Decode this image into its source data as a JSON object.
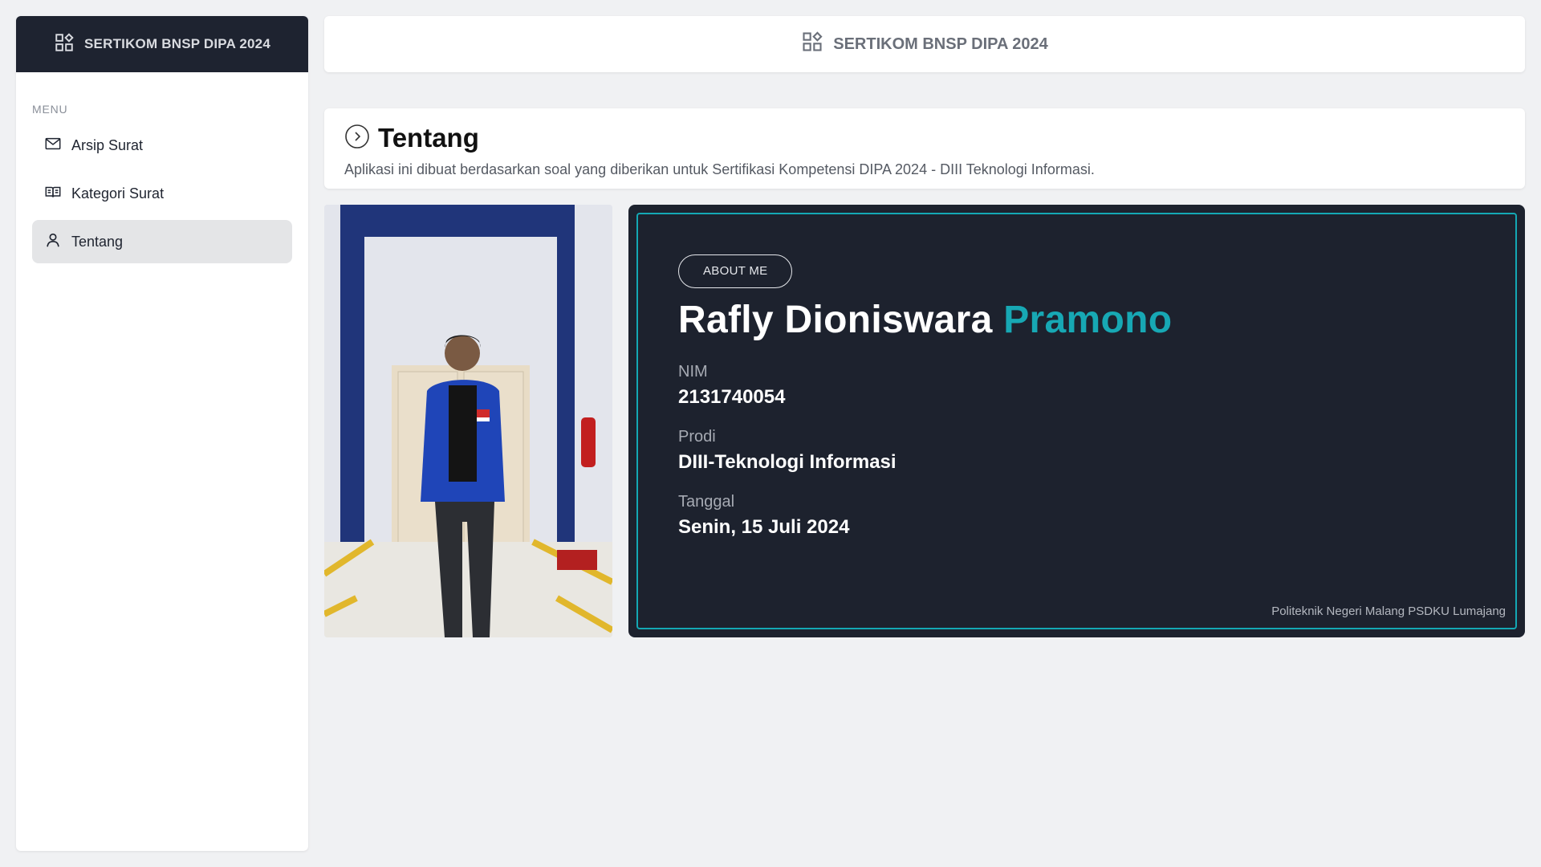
{
  "app": {
    "title": "SERTIKOM BNSP DIPA 2024"
  },
  "sidebar": {
    "title": "SERTIKOM BNSP DIPA 2024",
    "menu_label": "MENU",
    "items": [
      {
        "label": "Arsip Surat",
        "icon": "mail-icon",
        "active": false
      },
      {
        "label": "Kategori Surat",
        "icon": "book-open-icon",
        "active": false
      },
      {
        "label": "Tentang",
        "icon": "user-icon",
        "active": true
      }
    ]
  },
  "header": {
    "title": "SERTIKOM BNSP DIPA 2024",
    "icon": "dashboard-icon"
  },
  "page": {
    "title": "Tentang",
    "title_icon": "chevron-right-circle-icon",
    "description": "Aplikasi ini dibuat berdasarkan soal yang diberikan untuk Sertifikasi Kompetensi DIPA 2024 - DIII Teknologi Informasi."
  },
  "about": {
    "badge": "ABOUT ME",
    "name_main": "Rafly Dioniswara",
    "name_accent": "Pramono",
    "fields": [
      {
        "label": "NIM",
        "value": "2131740054"
      },
      {
        "label": "Prodi",
        "value": "DIII-Teknologi Informasi"
      },
      {
        "label": "Tanggal",
        "value": "Senin, 15 Juli 2024"
      }
    ],
    "footer": "Politeknik Negeri Malang PSDKU Lumajang"
  },
  "colors": {
    "accent": "#17a8b4",
    "dark": "#1d222e",
    "background": "#f0f1f3"
  }
}
